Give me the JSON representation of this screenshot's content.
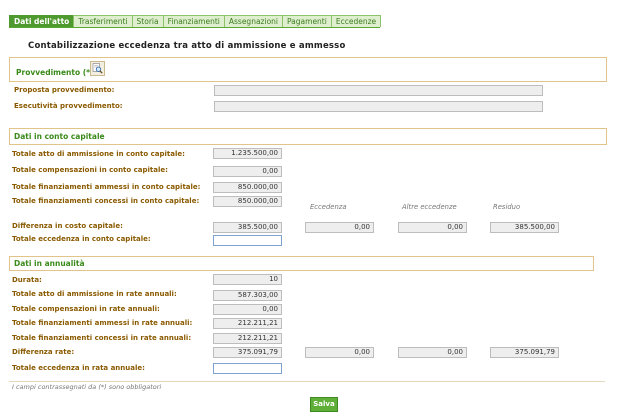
{
  "tabs": [
    "Dati dell'atto",
    "Trasferimenti",
    "Storia",
    "Finanziamenti",
    "Assegnazioni",
    "Pagamenti",
    "Eccedenze"
  ],
  "active_tab": "Dati dell'atto",
  "page_title": "Contabilizzazione eccedenza tra atto di ammissione e ammesso",
  "provvedimento": {
    "title": "Provvedimento (*)",
    "icon": "magnifier-document-icon",
    "proposta_label": "Proposta provvedimento:",
    "proposta_value": "",
    "esecutivita_label": "Esecutività provvedimento:",
    "esecutivita_value": ""
  },
  "capitale": {
    "title": "Dati in conto capitale",
    "rows": [
      {
        "label": "Totale atto di ammissione in conto capitale:",
        "value": "1.235.500,00"
      },
      {
        "label": "Totale compensazioni  in conto capitale:",
        "value": "0,00"
      },
      {
        "label": "Totale finanziamenti ammessi in conto capitale:",
        "value": "850.000,00"
      },
      {
        "label": "Totale finanziamenti concessi in conto capitale:",
        "value": "850.000,00"
      }
    ],
    "col_headers": [
      "Eccedenza",
      "Altre eccedenze",
      "Residuo"
    ],
    "differenza_label": "Differenza in costo capitale:",
    "differenza_values": [
      "385.500,00",
      "0,00",
      "0,00",
      "385.500,00"
    ],
    "eccedenza_label": "Totale eccedenza in conto capitale:",
    "eccedenza_value": ""
  },
  "annualita": {
    "title": "Dati in annualità",
    "rows": [
      {
        "label": "Durata:",
        "value": "10"
      },
      {
        "label": "Totale atto di ammissione in rate annuali:",
        "value": "587.303,00"
      },
      {
        "label": "Totale compensazioni in rate annuali:",
        "value": "0,00"
      },
      {
        "label": "Totale finanziamenti ammessi in rate annuali:",
        "value": "212.211,21"
      },
      {
        "label": "Totale finanziamenti concessi in rate annuali:",
        "value": "212.211,21"
      }
    ],
    "differenza_label": "Differenza rate:",
    "differenza_values": [
      "375.091,79",
      "0,00",
      "0,00",
      "375.091,79"
    ],
    "eccedenza_label": "Totale eccedenza in rata annuale:",
    "eccedenza_value": ""
  },
  "footnote": "I campi contrassegnati da (*) sono obbligatori",
  "save_label": "Salva"
}
